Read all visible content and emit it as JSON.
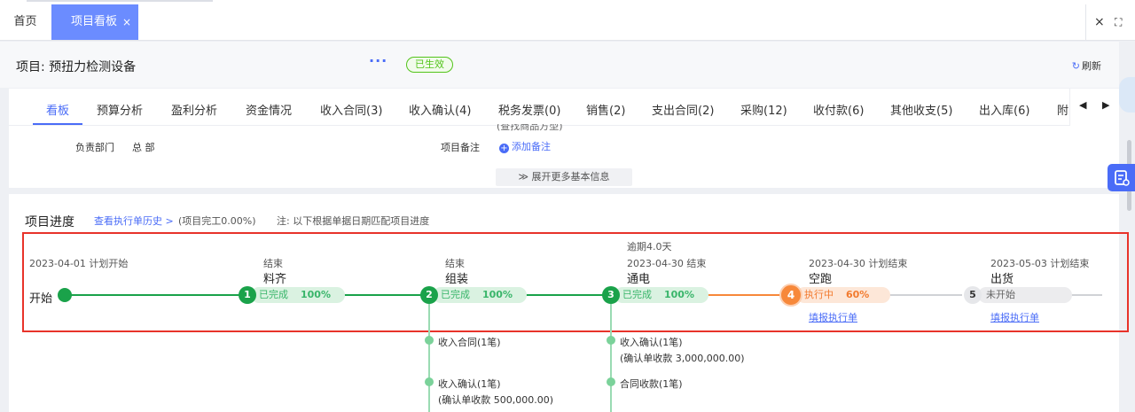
{
  "tabs": {
    "home": "首页",
    "active": "项目看板",
    "close": "×",
    "win_close": "×",
    "win_full": "⛶"
  },
  "header": {
    "title": "项目: 预扭力检测设备",
    "more": "···",
    "status": "已生效",
    "refresh": "刷新"
  },
  "nav": {
    "items": [
      "看板",
      "预算分析",
      "盈利分析",
      "资金情况",
      "收入合同(3)",
      "收入确认(4)",
      "税务发票(0)",
      "销售(2)",
      "支出合同(2)",
      "采购(12)",
      "收付款(6)",
      "其他收支(5)",
      "出入库(6)",
      "附"
    ],
    "prev": "◀",
    "next": "▶"
  },
  "info": {
    "cut_text": "(查找商品方型)",
    "dept_label": "负责部门",
    "dept_value": "总 部",
    "note_label": "项目备注",
    "note_add": "添加备注",
    "plus": "+",
    "expand": "≫ 展开更多基本信息"
  },
  "progress": {
    "title": "项目进度",
    "history_link": "查看执行单历史 >",
    "completion": "(项目完工0.00%)",
    "note": "注: 以下根据单据日期匹配项目进度",
    "start": {
      "date": "2023-04-01 计划开始",
      "label": "开始"
    },
    "milestones": [
      {
        "num": "1",
        "top": "结束",
        "name": "料齐",
        "status": "已完成",
        "pct": "100%"
      },
      {
        "num": "2",
        "top": "结束",
        "name": "组装",
        "status": "已完成",
        "pct": "100%"
      },
      {
        "num": "3",
        "overdue": "逾期4.0天",
        "top": "2023-04-30 结束",
        "name": "通电",
        "status": "已完成",
        "pct": "100%"
      },
      {
        "num": "4",
        "top": "2023-04-30 计划结束",
        "name": "空跑",
        "status": "执行中",
        "pct": "60%",
        "action": "填报执行单"
      },
      {
        "num": "5",
        "top": "2023-05-03 计划结束",
        "name": "出货",
        "status": "未开始",
        "action": "填报执行单"
      }
    ],
    "sub2": [
      {
        "title": "收入合同(1笔)"
      },
      {
        "title": "收入确认(1笔)",
        "detail": "(确认单收款 500,000.00)"
      }
    ],
    "sub3": [
      {
        "title": "收入确认(1笔)",
        "detail": "(确认单收款 3,000,000.00)"
      },
      {
        "title": "合同收款(1笔)"
      }
    ]
  },
  "colors": {
    "accent": "#4a6cf7",
    "done": "#1aa24a",
    "active": "#f7883a",
    "pending": "#d0d2d6",
    "alert": "#e8332a"
  }
}
